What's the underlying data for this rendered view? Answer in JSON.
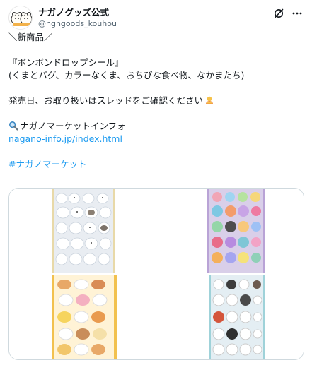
{
  "account": {
    "display_name": "ナガノグッズ公式",
    "handle": "@ngngoods_kouhou"
  },
  "header": {
    "icons": [
      "grok-icon",
      "more-icon"
    ]
  },
  "post": {
    "line1": "＼新商品／",
    "line2": "『ボンボンドロップシール』",
    "line3": "(くまとパグ、カラーなくま、おちびな食べ物、なかまたち)",
    "line4": "発売日、お取り扱いはスレッドをご確認ください",
    "line5": "ナガノマーケットインフォ",
    "link": "nagano-info.jp/index.html",
    "hashtag": "#ナガノマーケット"
  },
  "media": {
    "images": [
      {
        "subject": "sticker-sheet-kuma-pug"
      },
      {
        "subject": "sticker-sheet-color-kuma"
      },
      {
        "subject": "sticker-sheet-food"
      },
      {
        "subject": "sticker-sheet-friends"
      }
    ]
  },
  "colors": {
    "link": "#1d9bf0",
    "text": "#0f1419",
    "muted": "#536471"
  }
}
